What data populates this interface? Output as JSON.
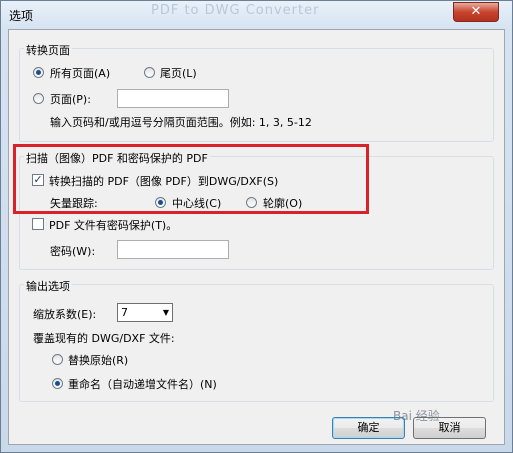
{
  "window": {
    "title": "选项",
    "background_title": "PDF to DWG Converter",
    "close_glyph": "✕"
  },
  "convert_pages": {
    "title": "转换页面",
    "all_pages": "所有页面(A)",
    "last_page": "尾页(L)",
    "pages": "页面(P):",
    "pages_value": "",
    "hint": "输入页码和/或用逗号分隔页面范围。例如: 1, 3, 5-12",
    "selected": "all_pages"
  },
  "scanned": {
    "title": "扫描（图像）PDF 和密码保护的 PDF",
    "convert_scanned": "转换扫描的 PDF（图像 PDF）到DWG/DXF(S)",
    "convert_checked": true,
    "vector_trace": "矢量跟踪:",
    "centerline": "中心线(C)",
    "outline": "轮廓(O)",
    "selected": "centerline",
    "password_protected": "PDF 文件有密码保护(T)。",
    "password_checked": false,
    "password_label": "密码(W):",
    "password_value": ""
  },
  "output": {
    "title": "输出选项",
    "scale_label": "缩放系数(E):",
    "scale_value": "7",
    "overwrite_label": "覆盖现有的 DWG/DXF 文件:",
    "replace": "替换原始(R)",
    "rename": "重命名（自动递增文件名）(N)",
    "selected": "rename"
  },
  "buttons": {
    "ok": "确定",
    "cancel": "取消"
  },
  "watermark": "Bai 经验"
}
